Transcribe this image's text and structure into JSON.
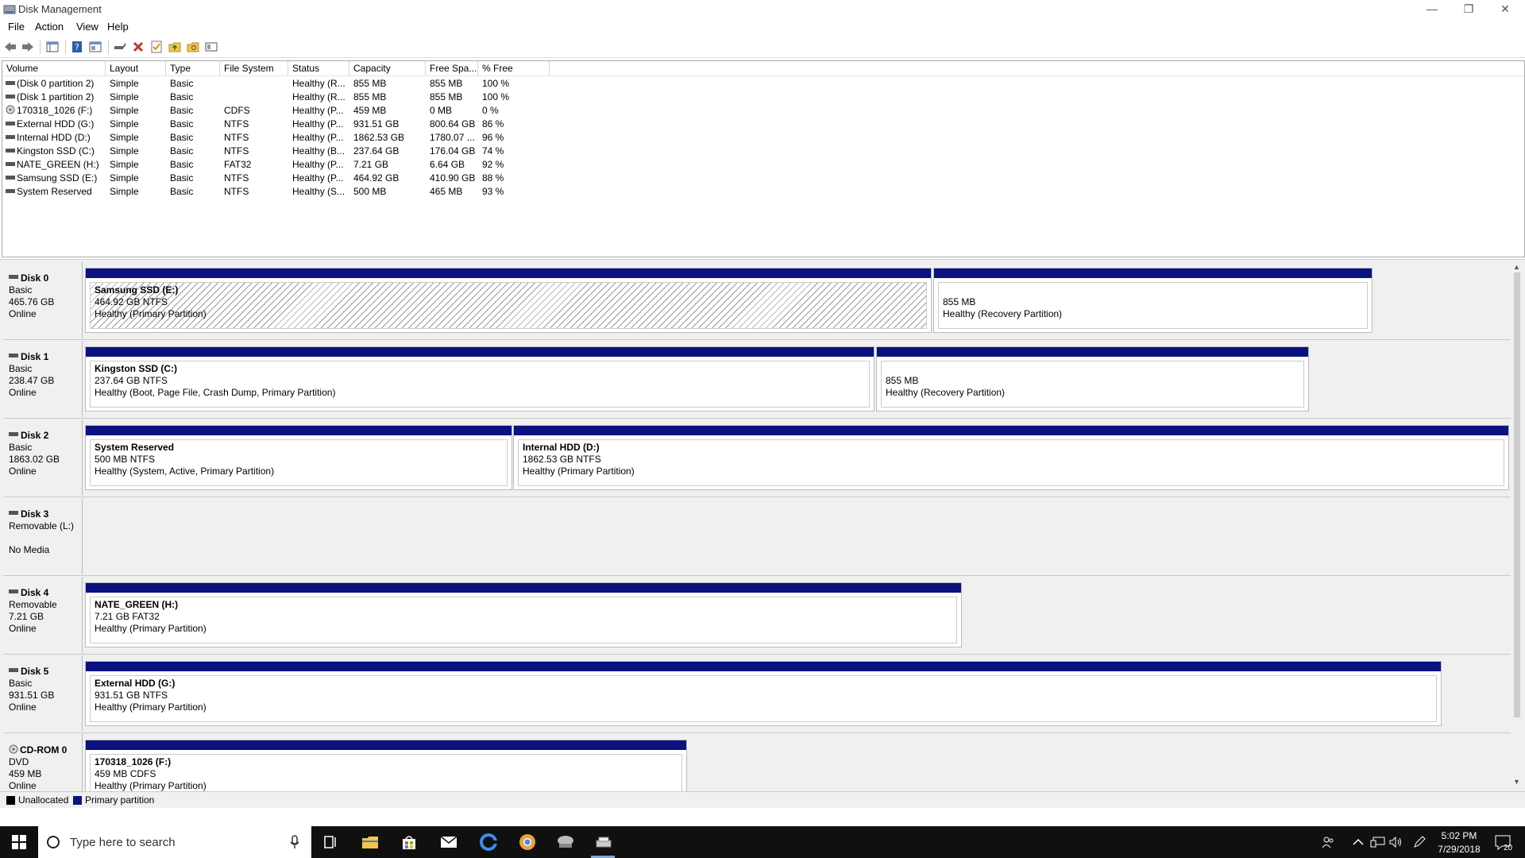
{
  "window": {
    "title": "Disk Management"
  },
  "menu": [
    "File",
    "Action",
    "View",
    "Help"
  ],
  "columns": [
    "Volume",
    "Layout",
    "Type",
    "File System",
    "Status",
    "Capacity",
    "Free Spa...",
    "% Free"
  ],
  "volumes": [
    {
      "volume": "(Disk 0 partition 2)",
      "layout": "Simple",
      "type": "Basic",
      "fs": "",
      "status": "Healthy (R...",
      "capacity": "855 MB",
      "free": "855 MB",
      "pct": "100 %"
    },
    {
      "volume": "(Disk 1 partition 2)",
      "layout": "Simple",
      "type": "Basic",
      "fs": "",
      "status": "Healthy (R...",
      "capacity": "855 MB",
      "free": "855 MB",
      "pct": "100 %"
    },
    {
      "volume": "170318_1026 (F:)",
      "layout": "Simple",
      "type": "Basic",
      "fs": "CDFS",
      "status": "Healthy (P...",
      "capacity": "459 MB",
      "free": "0 MB",
      "pct": "0 %"
    },
    {
      "volume": "External HDD (G:)",
      "layout": "Simple",
      "type": "Basic",
      "fs": "NTFS",
      "status": "Healthy (P...",
      "capacity": "931.51 GB",
      "free": "800.64 GB",
      "pct": "86 %"
    },
    {
      "volume": "Internal HDD (D:)",
      "layout": "Simple",
      "type": "Basic",
      "fs": "NTFS",
      "status": "Healthy (P...",
      "capacity": "1862.53 GB",
      "free": "1780.07 ...",
      "pct": "96 %"
    },
    {
      "volume": "Kingston SSD (C:)",
      "layout": "Simple",
      "type": "Basic",
      "fs": "NTFS",
      "status": "Healthy (B...",
      "capacity": "237.64 GB",
      "free": "176.04 GB",
      "pct": "74 %"
    },
    {
      "volume": "NATE_GREEN (H:)",
      "layout": "Simple",
      "type": "Basic",
      "fs": "FAT32",
      "status": "Healthy (P...",
      "capacity": "7.21 GB",
      "free": "6.64 GB",
      "pct": "92 %"
    },
    {
      "volume": "Samsung SSD (E:)",
      "layout": "Simple",
      "type": "Basic",
      "fs": "NTFS",
      "status": "Healthy (P...",
      "capacity": "464.92 GB",
      "free": "410.90 GB",
      "pct": "88 %"
    },
    {
      "volume": "System Reserved",
      "layout": "Simple",
      "type": "Basic",
      "fs": "NTFS",
      "status": "Healthy (S...",
      "capacity": "500 MB",
      "free": "465 MB",
      "pct": "93 %"
    }
  ],
  "disks": [
    {
      "name": "Disk 0",
      "l1": "Basic",
      "l2": "465.76 GB",
      "l3": "Online",
      "parts": [
        {
          "name": "Samsung SSD  (E:)",
          "size": "464.92 GB NTFS",
          "status": "Healthy (Primary Partition)"
        },
        {
          "name": "",
          "size": "855 MB",
          "status": "Healthy (Recovery Partition)"
        }
      ]
    },
    {
      "name": "Disk 1",
      "l1": "Basic",
      "l2": "238.47 GB",
      "l3": "Online",
      "parts": [
        {
          "name": "Kingston SSD  (C:)",
          "size": "237.64 GB NTFS",
          "status": "Healthy (Boot, Page File, Crash Dump, Primary Partition)"
        },
        {
          "name": "",
          "size": "855 MB",
          "status": "Healthy (Recovery Partition)"
        }
      ]
    },
    {
      "name": "Disk 2",
      "l1": "Basic",
      "l2": "1863.02 GB",
      "l3": "Online",
      "parts": [
        {
          "name": "System Reserved",
          "size": "500 MB NTFS",
          "status": "Healthy (System, Active, Primary Partition)"
        },
        {
          "name": "Internal HDD  (D:)",
          "size": "1862.53 GB NTFS",
          "status": "Healthy (Primary Partition)"
        }
      ]
    },
    {
      "name": "Disk 3",
      "l1": "Removable (L:)",
      "l2": "",
      "l3": "No Media",
      "parts": []
    },
    {
      "name": "Disk 4",
      "l1": "Removable",
      "l2": "7.21 GB",
      "l3": "Online",
      "parts": [
        {
          "name": "NATE_GREEN  (H:)",
          "size": "7.21 GB FAT32",
          "status": "Healthy (Primary Partition)"
        }
      ]
    },
    {
      "name": "Disk 5",
      "l1": "Basic",
      "l2": "931.51 GB",
      "l3": "Online",
      "parts": [
        {
          "name": "External HDD  (G:)",
          "size": "931.51 GB NTFS",
          "status": "Healthy (Primary Partition)"
        }
      ]
    },
    {
      "name": "CD-ROM 0",
      "l1": "DVD",
      "l2": "459 MB",
      "l3": "Online",
      "parts": [
        {
          "name": "170318_1026  (F:)",
          "size": "459 MB CDFS",
          "status": "Healthy (Primary Partition)"
        }
      ]
    }
  ],
  "legend": {
    "unallocated": "Unallocated",
    "primary": "Primary partition"
  },
  "colors": {
    "primary_bar": "#0a127f",
    "unallocated": "#000000",
    "taskbar": "#101010"
  },
  "taskbar": {
    "search_placeholder": "Type here to search",
    "time": "5:02 PM",
    "date": "7/29/2018",
    "notifications": "20"
  }
}
